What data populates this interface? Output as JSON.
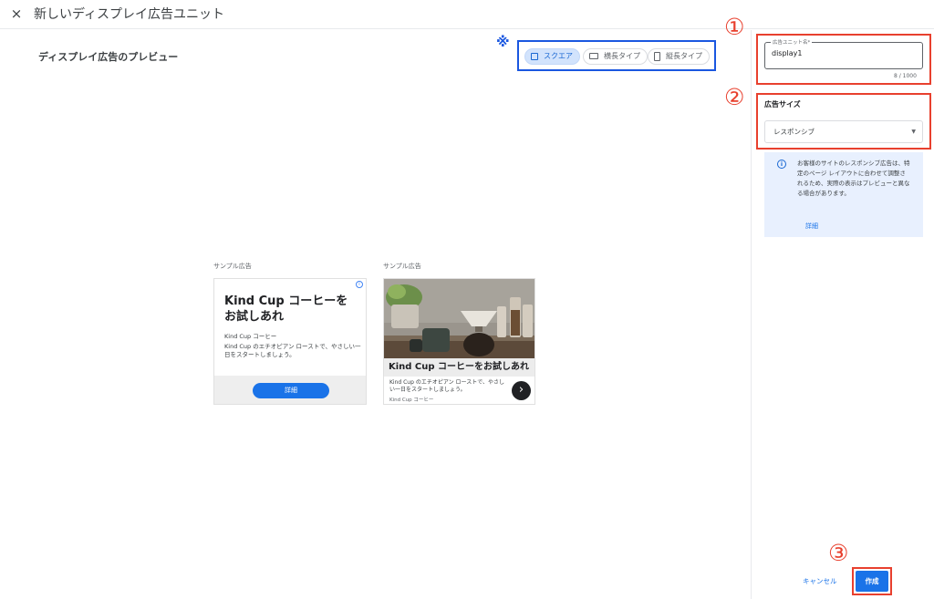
{
  "header": {
    "close_icon": "×",
    "title": "新しいディスプレイ広告ユニット"
  },
  "preview": {
    "title": "ディスプレイ広告のプレビュー",
    "asterisk": "※",
    "toggle": [
      {
        "label": "スクエア",
        "icon": "square-icon",
        "selected": true
      },
      {
        "label": "横長タイプ",
        "icon": "landscape-icon",
        "selected": false
      },
      {
        "label": "縦長タイプ",
        "icon": "portrait-icon",
        "selected": false
      }
    ]
  },
  "ads": [
    {
      "sample_label": "サンプル広告",
      "headline": "Kind Cup コーヒーを お試しあれ",
      "brand": "Kind Cup コーヒー",
      "body": "Kind Cup のエチオピアン ローストで、やさしい一日をスタートしましょう。",
      "button": "詳細",
      "info_icon": "i"
    },
    {
      "sample_label": "サンプル広告",
      "headline": "Kind Cup コーヒーをお試しあれ",
      "body": "Kind Cup のエチオピアン ローストで、やさしい一日をスタートしましょう。",
      "brand": "Kind Cup コーヒー",
      "arrow_icon": "›"
    }
  ],
  "sidebar": {
    "marks": [
      "①",
      "②",
      "③"
    ],
    "name_field": {
      "label": "広告ユニット名*",
      "value": "display1",
      "counter": "8 / 1000"
    },
    "size": {
      "label": "広告サイズ",
      "selected": "レスポンシブ",
      "caret": "▼"
    },
    "info": {
      "icon": "i",
      "text": "お客様のサイトのレスポンシブ広告は、特定のページ レイアウトに合わせて調整されるため、実際の表示はプレビューと異なる場合があります。",
      "link": "詳細"
    },
    "actions": {
      "cancel": "キャンセル",
      "create": "作成"
    }
  },
  "colors": {
    "accent": "#1a73e8",
    "annotation_red": "#e8402e",
    "annotation_blue": "#1a57e0"
  }
}
